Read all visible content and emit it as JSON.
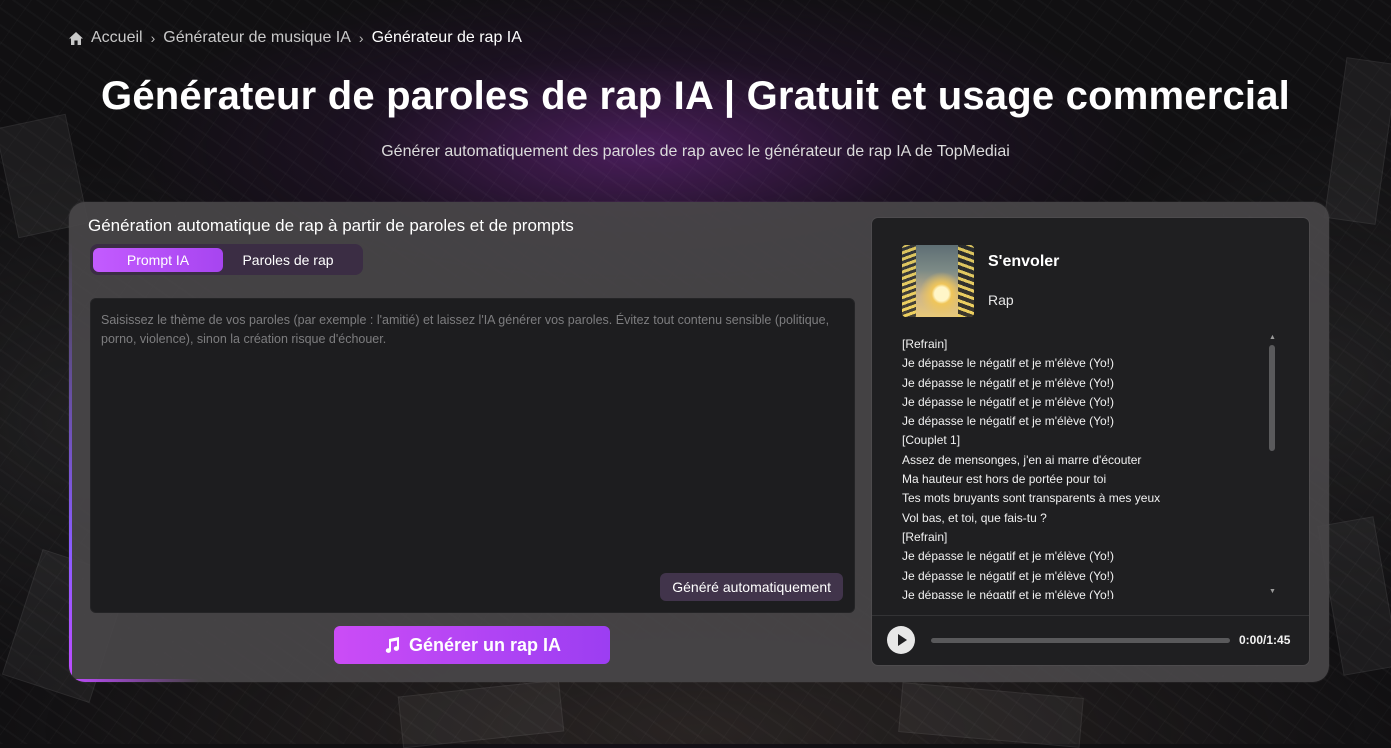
{
  "breadcrumb": {
    "home_label": "Accueil",
    "items": [
      "Générateur de musique IA"
    ],
    "current": "Générateur de rap IA",
    "separator_icon": "chevron-right-icon",
    "home_icon": "home-icon"
  },
  "page": {
    "title": "Générateur de paroles de rap IA | Gratuit et usage commercial",
    "subtitle": "Générer automatiquement des paroles de rap avec le générateur de rap IA de TopMediai"
  },
  "generator": {
    "heading": "Génération automatique de rap à partir de paroles et de prompts",
    "tabs": [
      {
        "label": "Prompt IA",
        "active": true
      },
      {
        "label": "Paroles de rap",
        "active": false
      }
    ],
    "prompt": {
      "value": "",
      "placeholder": "Saisissez le thème de vos paroles (par exemple : l'amitié) et laissez l'IA générer vos paroles. Évitez tout contenu sensible (politique, porno, violence), sinon la création risque d'échouer."
    },
    "auto_button_label": "Généré automatiquement",
    "generate_button_label": "Générer un rap IA",
    "generate_button_icon": "music-note-icon"
  },
  "player": {
    "song_title": "S'envoler",
    "genre": "Rap",
    "lyrics": [
      "[Refrain]",
      "Je dépasse le négatif et je m'élève (Yo!)",
      "Je dépasse le négatif et je m'élève (Yo!)",
      "Je dépasse le négatif et je m'élève (Yo!)",
      "Je dépasse le négatif et je m'élève (Yo!)",
      "[Couplet 1]",
      "Assez de mensonges, j'en ai marre d'écouter",
      "Ma hauteur est hors de portée pour toi",
      "Tes mots bruyants sont transparents à mes yeux",
      "Vol bas, et toi, que fais-tu ?",
      "[Refrain]",
      "Je dépasse le négatif et je m'élève (Yo!)",
      "Je dépasse le négatif et je m'élève (Yo!)",
      "Je dépasse le négatif et je m'élève (Yo!)"
    ],
    "current_time": "0:00",
    "duration": "1:45",
    "progress": 0,
    "play_icon": "play-icon",
    "accent_color": "#c552ff"
  },
  "colors": {
    "accent_gradient_start": "#cb4cf6",
    "accent_gradient_end": "#9c3ef2",
    "panel_bg": "#484648",
    "dark_box": "#1d1d1f"
  }
}
